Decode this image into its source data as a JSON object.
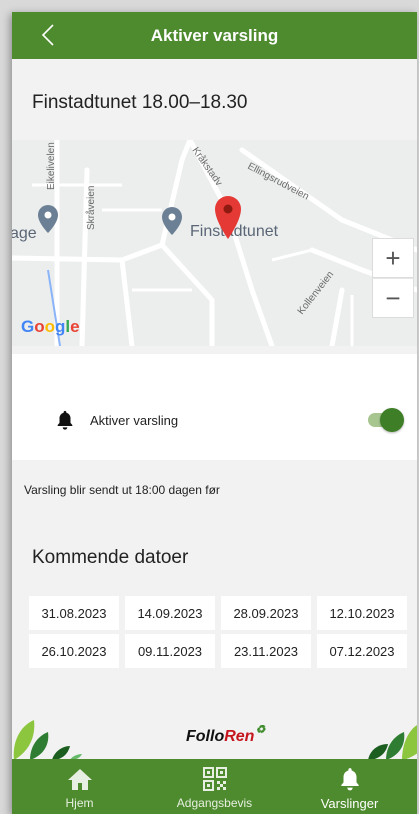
{
  "header": {
    "title": "Aktiver varsling",
    "back_icon": "chevron-left-icon"
  },
  "location": {
    "title": "Finstadtunet 18.00–18.30"
  },
  "map": {
    "provider_logo": "Google",
    "place_label": "Finstadtunet",
    "left_label": "age",
    "streets": [
      "Eikelivelen",
      "Skråveien",
      "Kråkstadv",
      "Ellingsrudveien",
      "Kollenveien"
    ],
    "zoom_in": "+",
    "zoom_out": "−"
  },
  "alert": {
    "label": "Aktiver varsling",
    "enabled": true,
    "accent": "#3d7e26"
  },
  "notice": "Varsling blir sendt ut 18:00 dagen før",
  "upcoming": {
    "title": "Kommende datoer",
    "dates": [
      "31.08.2023",
      "14.09.2023",
      "28.09.2023",
      "12.10.2023",
      "26.10.2023",
      "09.11.2023",
      "23.11.2023",
      "07.12.2023"
    ]
  },
  "brand": {
    "part1": "Follo",
    "part2": "Ren",
    "mark": "♻"
  },
  "nav": {
    "items": [
      {
        "label": "Hjem",
        "icon": "home-icon"
      },
      {
        "label": "Adgangsbevis",
        "icon": "qr-code-icon"
      },
      {
        "label": "Varslinger",
        "icon": "bell-icon"
      }
    ],
    "active_index": 2,
    "color": "#4e8b2e"
  }
}
